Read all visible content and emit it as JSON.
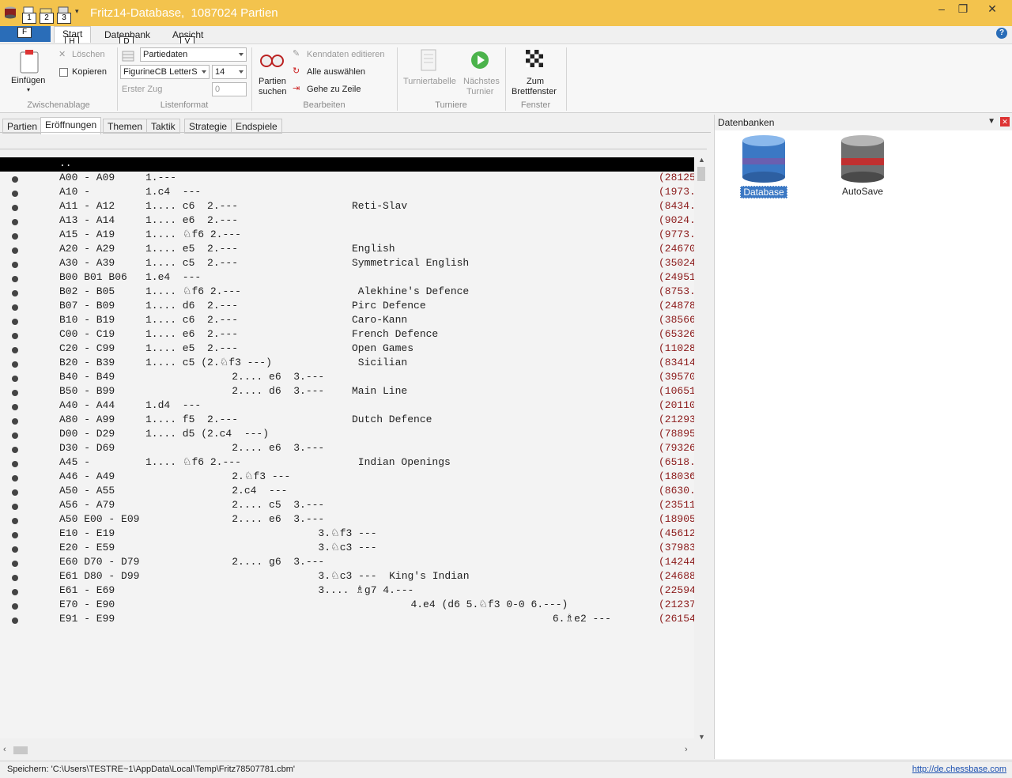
{
  "window": {
    "title": "Fritz14-Database,  1087024 Partien",
    "keytips_quick": [
      "1",
      "2",
      "3"
    ],
    "minimize": "‒",
    "restore": "❐",
    "close": "✕"
  },
  "ribbon_tabs": {
    "file_keytip": "F",
    "tabs": [
      {
        "label": "Start",
        "keytip": "H"
      },
      {
        "label": "Datenbank",
        "keytip": "D"
      },
      {
        "label": "Ansicht",
        "keytip": "V"
      }
    ],
    "help": "?"
  },
  "ribbon": {
    "clipboard": {
      "paste": "Einfügen",
      "delete": "Löschen",
      "copy": "Kopieren",
      "group": "Zwischenablage"
    },
    "listformat": {
      "view_combo": "Partiedaten",
      "font_combo": "FigurineCB LetterS",
      "size_combo": "14",
      "first_move_label": "Erster Zug",
      "first_move_value": "0",
      "group": "Listenformat"
    },
    "edit": {
      "search_line1": "Partien",
      "search_line2": "suchen",
      "edit_key": "Kenndaten editieren",
      "select_all": "Alle auswählen",
      "goto_line": "Gehe zu Zeile",
      "group": "Bearbeiten"
    },
    "tournaments": {
      "table": "Turniertabelle",
      "next_line1": "Nächstes",
      "next_line2": "Turnier",
      "group": "Turniere"
    },
    "window": {
      "board_line1": "Zum",
      "board_line2": "Brettfenster",
      "group": "Fenster"
    }
  },
  "subtabs": [
    "Partien",
    "Eröffnungen",
    "Themen",
    "Taktik",
    "Strategie",
    "Endspiele"
  ],
  "list": {
    "header": "..",
    "rows": [
      {
        "code": "A00 - A09",
        "moves": "1.---",
        "name": "",
        "count": "(28125"
      },
      {
        "code": "A10 -",
        "moves": "1.c4  ---",
        "name": "",
        "count": "(1973."
      },
      {
        "code": "A11 - A12",
        "moves": "1.... c6  2.---",
        "name": "Reti-Slav",
        "count": "(8434."
      },
      {
        "code": "A13 - A14",
        "moves": "1.... e6  2.---",
        "name": "",
        "count": "(9024."
      },
      {
        "code": "A15 - A19",
        "moves": "1.... ♘f6 2.---",
        "name": "",
        "count": "(9773."
      },
      {
        "code": "A20 - A29",
        "moves": "1.... e5  2.---",
        "name": "English",
        "count": "(24670"
      },
      {
        "code": "A30 - A39",
        "moves": "1.... c5  2.---",
        "name": "Symmetrical English",
        "count": "(35024"
      },
      {
        "code": "B00 B01 B06",
        "moves": "1.e4  ---",
        "name": "",
        "count": "(24951"
      },
      {
        "code": "B02 - B05",
        "moves": "1.... ♘f6 2.---",
        "name": " Alekhine's Defence",
        "count": "(8753."
      },
      {
        "code": "B07 - B09",
        "moves": "1.... d6  2.---",
        "name": "Pirc Defence",
        "count": "(24878"
      },
      {
        "code": "B10 - B19",
        "moves": "1.... c6  2.---",
        "name": "Caro-Kann",
        "count": "(38566"
      },
      {
        "code": "C00 - C19",
        "moves": "1.... e6  2.---",
        "name": "French Defence",
        "count": "(65326"
      },
      {
        "code": "C20 - C99",
        "moves": "1.... e5  2.---",
        "name": "Open Games",
        "count": "(11028"
      },
      {
        "code": "B20 - B39",
        "moves": "1.... c5 (2.♘f3 ---)",
        "name": " Sicilian",
        "count": "(83414"
      },
      {
        "code": "B40 - B49",
        "moves": "              2.... e6  3.---",
        "name": "",
        "count": "(39570"
      },
      {
        "code": "B50 - B99",
        "moves": "              2.... d6  3.---",
        "name": "Main Line",
        "count": "(10651"
      },
      {
        "code": "A40 - A44",
        "moves": "1.d4  ---",
        "name": "",
        "count": "(20110"
      },
      {
        "code": "A80 - A99",
        "moves": "1.... f5  2.---",
        "name": "Dutch Defence",
        "count": "(21293"
      },
      {
        "code": "D00 - D29",
        "moves": "1.... d5 (2.c4  ---)",
        "name": "",
        "count": "(78895"
      },
      {
        "code": "D30 - D69",
        "moves": "              2.... e6  3.---",
        "name": "",
        "count": "(79326"
      },
      {
        "code": "A45 -",
        "moves": "1.... ♘f6 2.---",
        "name": " Indian Openings",
        "count": "(6518."
      },
      {
        "code": "A46 - A49",
        "moves": "              2.♘f3 ---",
        "name": "",
        "count": "(18036"
      },
      {
        "code": "A50 - A55",
        "moves": "              2.c4  ---",
        "name": "",
        "count": "(8630."
      },
      {
        "code": "A56 - A79",
        "moves": "              2.... c5  3.---",
        "name": "",
        "count": "(23511"
      },
      {
        "code": "A50 E00 - E09",
        "moves": "              2.... e6  3.---",
        "name": "",
        "count": "(18905"
      },
      {
        "code": "E10 - E19",
        "moves": "                            3.♘f3 ---",
        "name": "",
        "count": "(45612"
      },
      {
        "code": "E20 - E59",
        "moves": "                            3.♘c3 ---",
        "name": "",
        "count": "(37983"
      },
      {
        "code": "E60 D70 - D79",
        "moves": "              2.... g6  3.---",
        "name": "",
        "count": "(14244"
      },
      {
        "code": "E61 D80 - D99",
        "moves": "                            3.♘c3 ---  King's Indian",
        "name": "",
        "count": "(24688"
      },
      {
        "code": "E61 - E69",
        "moves": "                            3.... ♗g7 4.---",
        "name": "",
        "count": "(22594"
      },
      {
        "code": "E70 - E90",
        "moves": "                                           4.e4 (d6 5.♘f3 0-0 6.---)",
        "name": "",
        "count": "(21237"
      },
      {
        "code": "E91 - E99",
        "moves": "                                                                  6.♗e2 ---",
        "name": "",
        "count": "(26154"
      }
    ]
  },
  "panel": {
    "title": "Datenbanken",
    "databases": [
      {
        "name": "Database",
        "color": "#3b78c4",
        "selected": true
      },
      {
        "name": "AutoSave",
        "color": "#c03030",
        "selected": false
      }
    ]
  },
  "status": {
    "path": "Speichern: 'C:\\Users\\TESTRE~1\\AppData\\Local\\Temp\\Fritz78507781.cbm'",
    "link": "http://de.chessbase.com"
  }
}
